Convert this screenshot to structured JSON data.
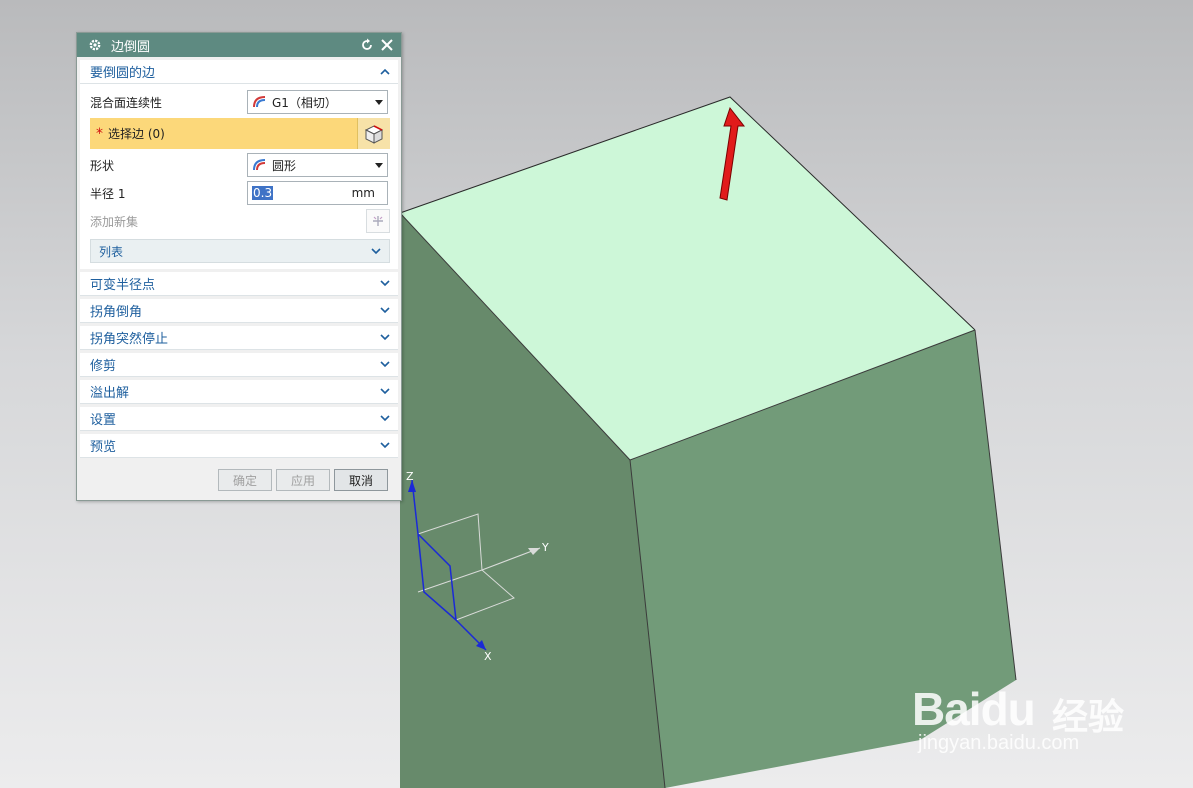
{
  "dialog": {
    "title": "边倒圆",
    "primary_section": {
      "label": "要倒圆的边",
      "blend_continuity": {
        "label": "混合面连续性",
        "value": "G1（相切）"
      },
      "select_edge": {
        "required_mark": "*",
        "label": "选择边 (0)"
      },
      "shape": {
        "label": "形状",
        "value": "圆形"
      },
      "radius": {
        "label": "半径 1",
        "value": "0.3",
        "unit": "mm"
      },
      "add_new_set": {
        "label": "添加新集"
      },
      "list": {
        "label": "列表"
      }
    },
    "sections": [
      {
        "label": "可变半径点"
      },
      {
        "label": "拐角倒角"
      },
      {
        "label": "拐角突然停止"
      },
      {
        "label": "修剪"
      },
      {
        "label": "溢出解"
      },
      {
        "label": "设置"
      },
      {
        "label": "预览"
      }
    ],
    "buttons": {
      "ok": "确定",
      "apply": "应用",
      "cancel": "取消"
    }
  },
  "viewport": {
    "triad_axes": {
      "y_label": "Y",
      "x_label": "X",
      "z_label": "Z"
    },
    "colors": {
      "top_face": "#cdf7d8",
      "right_face": "#729b79",
      "left_face": "#678a6b",
      "selection_arrow": "#e11b1b"
    }
  },
  "watermark": {
    "brand": "Baidu",
    "product": "经验",
    "url": "jingyan.baidu.com"
  }
}
